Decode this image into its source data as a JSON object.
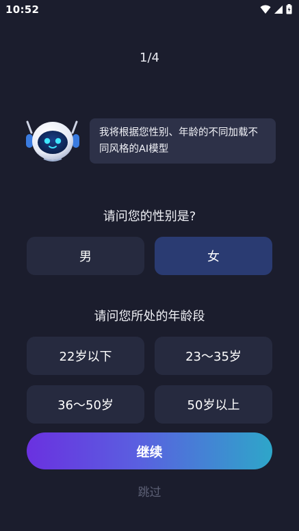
{
  "status_bar": {
    "time": "10:52"
  },
  "progress": {
    "step_text": "1/4"
  },
  "assistant": {
    "message": "我将根据您性别、年龄的不同加载不同风格的AI模型"
  },
  "gender_question": {
    "title": "请问您的性别是?",
    "options": [
      "男",
      "女"
    ],
    "selected": "女"
  },
  "age_question": {
    "title": "请问您所处的年龄段",
    "options": [
      "22岁以下",
      "23～35岁",
      "36～50岁",
      "50岁以上"
    ]
  },
  "actions": {
    "continue_label": "继续",
    "skip_label": "跳过"
  },
  "colors": {
    "background": "#1b1d2d",
    "option_bg": "#262a3f",
    "option_selected_bg": "#2a3b72",
    "bubble_bg": "#2d3148",
    "gradient_start": "#6a31e0",
    "gradient_end": "#2ea6c9"
  }
}
